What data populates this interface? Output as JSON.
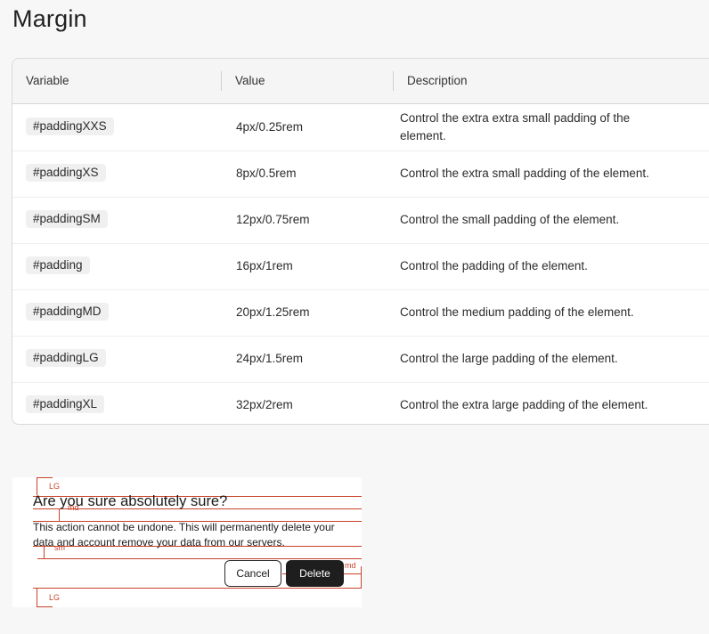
{
  "page": {
    "title": "Margin"
  },
  "table": {
    "headers": {
      "variable": "Variable",
      "value": "Value",
      "description": "Description"
    },
    "rows": [
      {
        "variable": "#paddingXXS",
        "value": "4px/0.25rem",
        "description": "Control the extra extra small padding of the element."
      },
      {
        "variable": "#paddingXS",
        "value": "8px/0.5rem",
        "description": "Control the extra small padding of the element."
      },
      {
        "variable": "#paddingSM",
        "value": "12px/0.75rem",
        "description": "Control the small padding of the element."
      },
      {
        "variable": "#padding",
        "value": "16px/1rem",
        "description": "Control the padding of the element."
      },
      {
        "variable": "#paddingMD",
        "value": "20px/1.25rem",
        "description": "Control the medium padding of the element."
      },
      {
        "variable": "#paddingLG",
        "value": "24px/1.5rem",
        "description": "Control the large padding of the element."
      },
      {
        "variable": "#paddingXL",
        "value": "32px/2rem",
        "description": "Control the extra large padding of the element."
      }
    ]
  },
  "dialog_demo": {
    "title": "Are you sure absolutely sure?",
    "body": "This action cannot be undone. This will permanently delete your data and  account remove your data from our servers.",
    "cancel_label": "Cancel",
    "delete_label": "Delete",
    "spacing_labels": {
      "top": "LG",
      "title_gap": "md",
      "body_gap": "sm",
      "button_gap": "md",
      "bottom": "LG"
    }
  },
  "colors": {
    "guide": "#c9432a",
    "delete_button": "#1e1e1e",
    "header_bg": "#f5f5f5",
    "tag_bg": "#f0f0f0"
  }
}
